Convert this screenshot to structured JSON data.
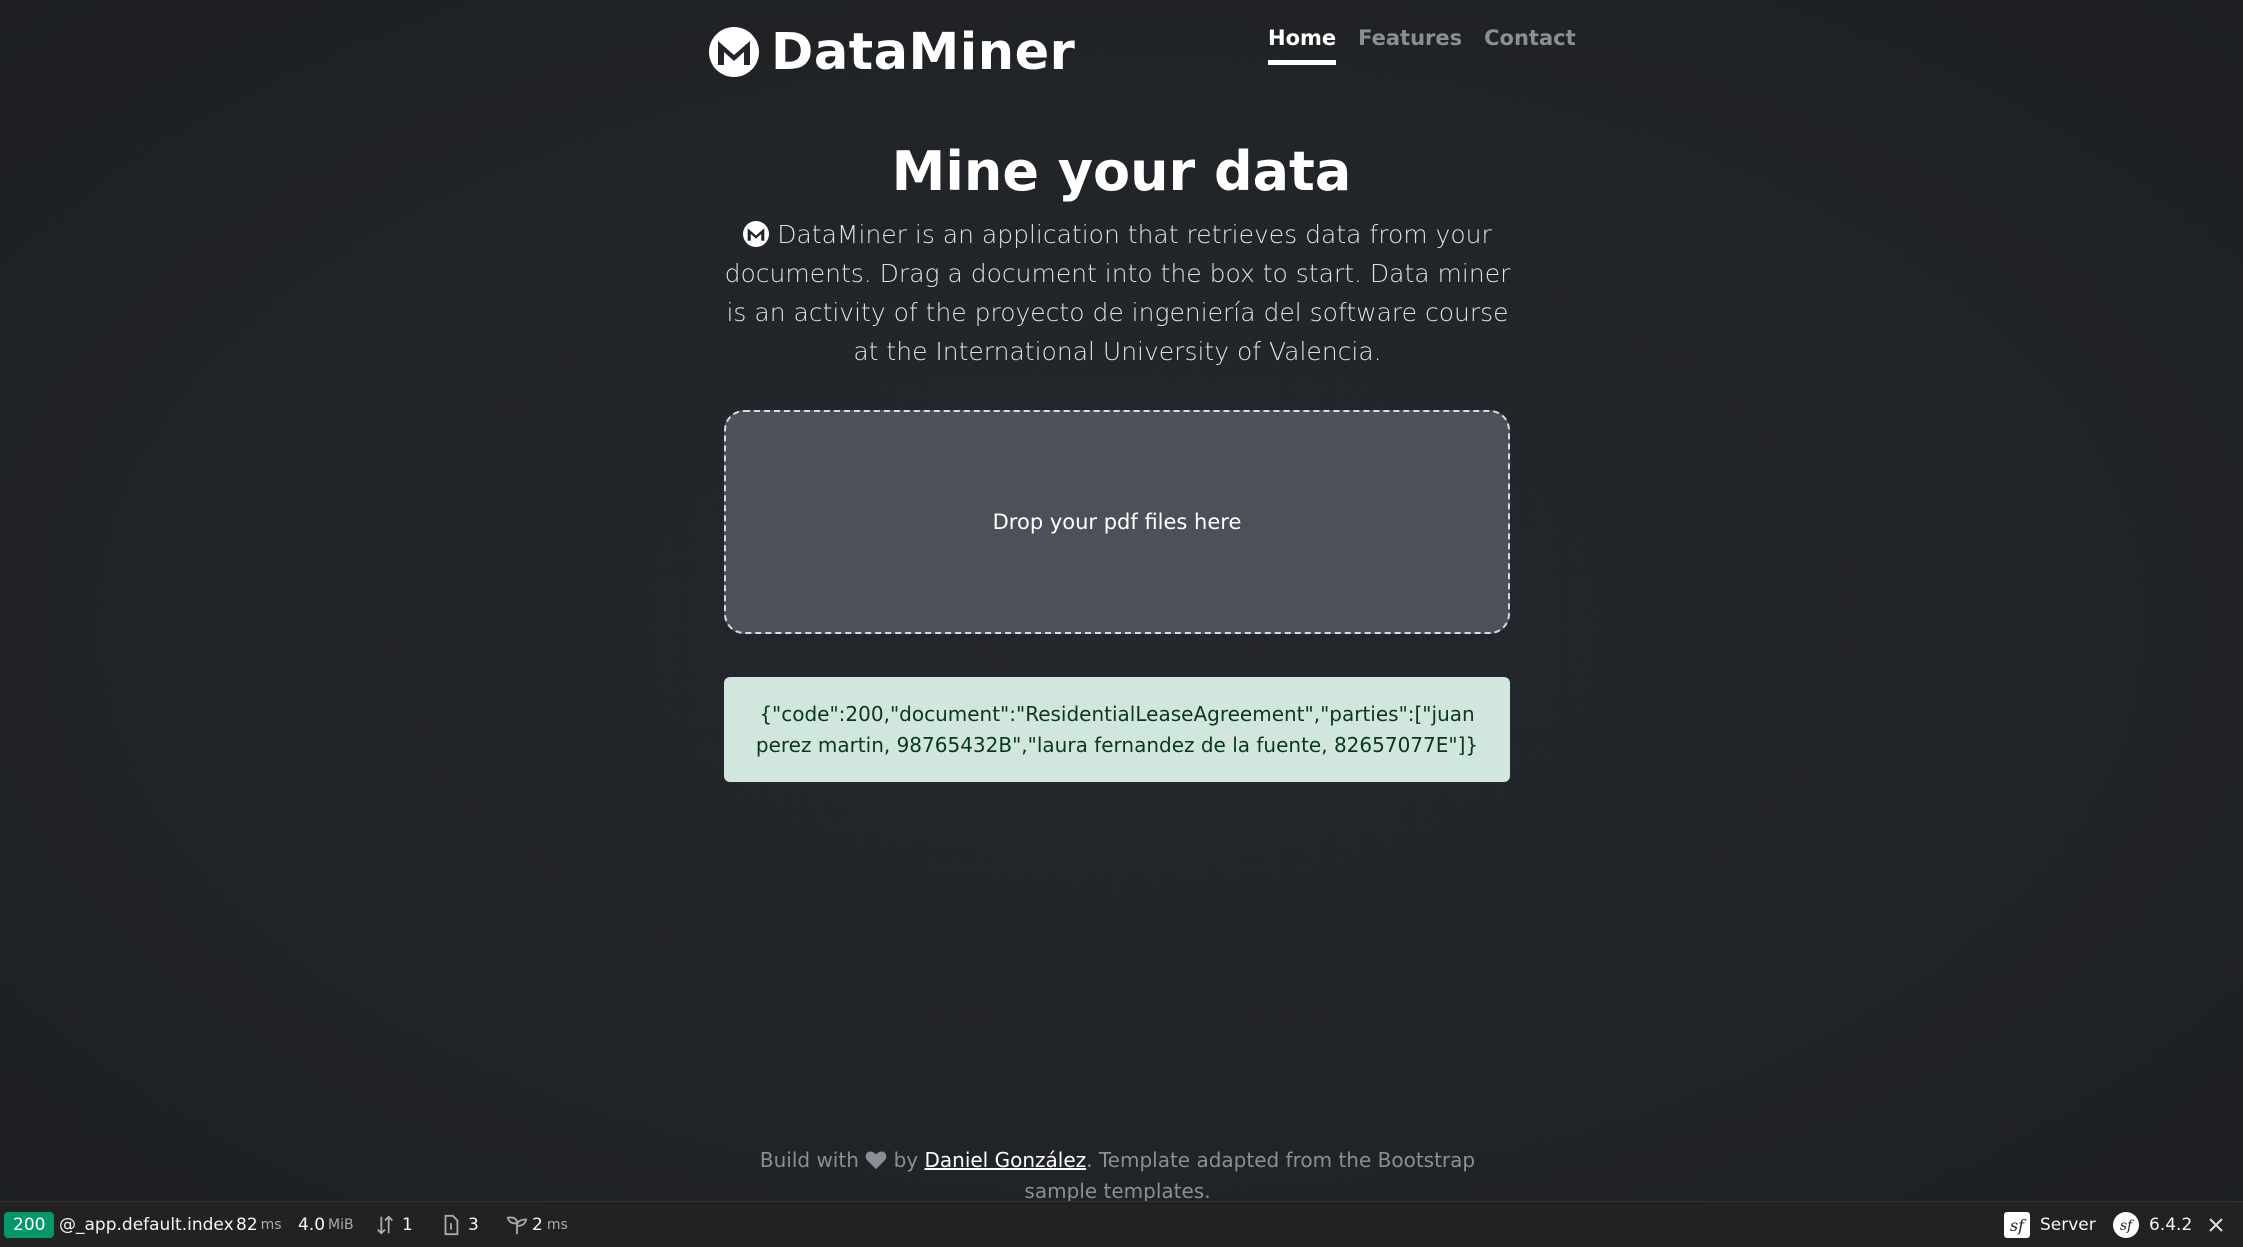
{
  "brand": {
    "name": "DataMiner",
    "logo_icon": "dataminer-m-logo-icon"
  },
  "nav": {
    "items": [
      {
        "label": "Home",
        "active": true
      },
      {
        "label": "Features",
        "active": false
      },
      {
        "label": "Contact",
        "active": false
      }
    ]
  },
  "hero": {
    "title": "Mine your data",
    "description": "DataMiner is an application that retrieves data from your documents. Drag a document into the box to start. Data miner is an activity of the proyecto de ingeniería del software course at the International University of Valencia."
  },
  "dropzone": {
    "label": "Drop your pdf files here"
  },
  "result": {
    "text": "{\"code\":200,\"document\":\"ResidentialLeaseAgreement\",\"parties\":[\"juan perez martin, 98765432B\",\"laura fernandez de la fuente, 82657077E\"]}"
  },
  "footer": {
    "prefix": "Build with",
    "by": "by",
    "author": "Daniel González",
    "suffix": ". Template adapted from the Bootstrap sample templates."
  },
  "toolbar": {
    "status_code": "200",
    "route": "@_app.default.index",
    "time_value": "82",
    "time_unit": "ms",
    "memory_value": "4.0",
    "memory_unit": "MiB",
    "requests": "1",
    "templates": "3",
    "events_value": "2",
    "events_unit": "ms",
    "server_label": "Server",
    "version": "6.4.2",
    "colors": {
      "status": "#059669"
    }
  }
}
